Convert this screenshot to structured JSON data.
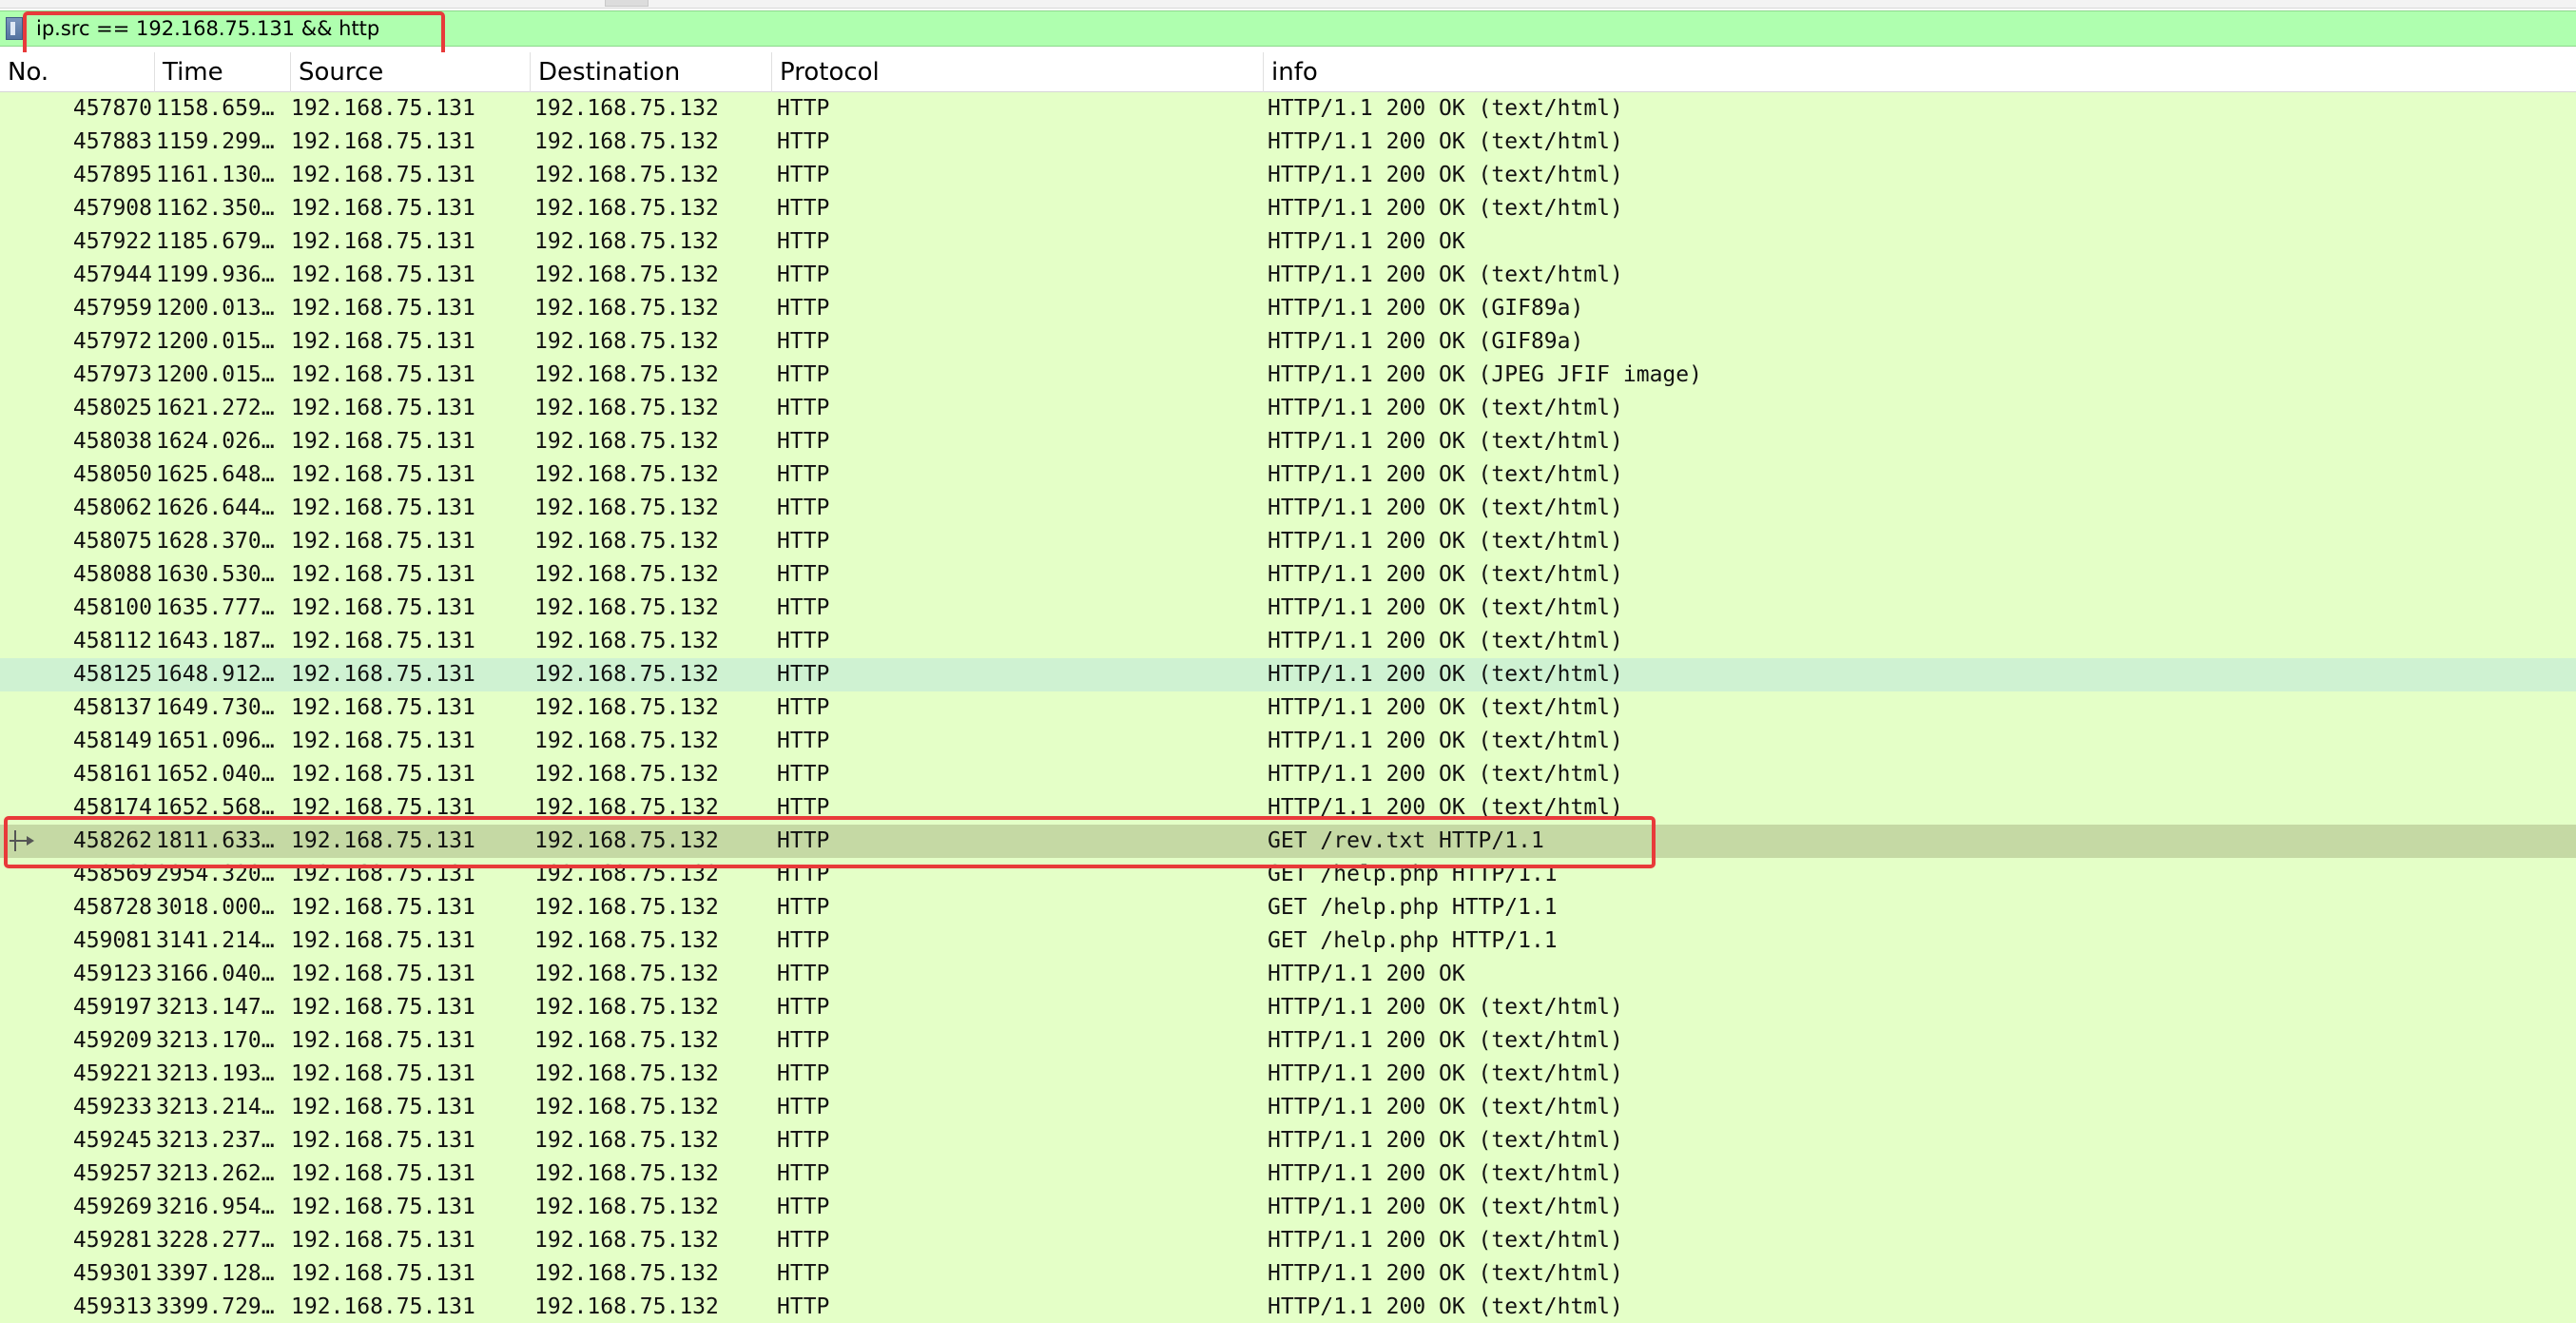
{
  "filter": {
    "value": "ip.src == 192.168.75.131 && http"
  },
  "columns": [
    "No.",
    "Time",
    "Source",
    "Destination",
    "Protocol",
    "info"
  ],
  "rows": [
    {
      "no": "457870",
      "time": "1158.659…",
      "src": "192.168.75.131",
      "dst": "192.168.75.132",
      "proto": "HTTP",
      "info": "HTTP/1.1 200 OK  (text/html)"
    },
    {
      "no": "457883",
      "time": "1159.299…",
      "src": "192.168.75.131",
      "dst": "192.168.75.132",
      "proto": "HTTP",
      "info": "HTTP/1.1 200 OK  (text/html)"
    },
    {
      "no": "457895",
      "time": "1161.130…",
      "src": "192.168.75.131",
      "dst": "192.168.75.132",
      "proto": "HTTP",
      "info": "HTTP/1.1 200 OK  (text/html)"
    },
    {
      "no": "457908",
      "time": "1162.350…",
      "src": "192.168.75.131",
      "dst": "192.168.75.132",
      "proto": "HTTP",
      "info": "HTTP/1.1 200 OK  (text/html)"
    },
    {
      "no": "457922",
      "time": "1185.679…",
      "src": "192.168.75.131",
      "dst": "192.168.75.132",
      "proto": "HTTP",
      "info": "HTTP/1.1 200 OK"
    },
    {
      "no": "457944",
      "time": "1199.936…",
      "src": "192.168.75.131",
      "dst": "192.168.75.132",
      "proto": "HTTP",
      "info": "HTTP/1.1 200 OK  (text/html)"
    },
    {
      "no": "457959",
      "time": "1200.013…",
      "src": "192.168.75.131",
      "dst": "192.168.75.132",
      "proto": "HTTP",
      "info": "HTTP/1.1 200 OK  (GIF89a)"
    },
    {
      "no": "457972",
      "time": "1200.015…",
      "src": "192.168.75.131",
      "dst": "192.168.75.132",
      "proto": "HTTP",
      "info": "HTTP/1.1 200 OK  (GIF89a)"
    },
    {
      "no": "457973",
      "time": "1200.015…",
      "src": "192.168.75.131",
      "dst": "192.168.75.132",
      "proto": "HTTP",
      "info": "HTTP/1.1 200 OK  (JPEG JFIF image)"
    },
    {
      "no": "458025",
      "time": "1621.272…",
      "src": "192.168.75.131",
      "dst": "192.168.75.132",
      "proto": "HTTP",
      "info": "HTTP/1.1 200 OK  (text/html)"
    },
    {
      "no": "458038",
      "time": "1624.026…",
      "src": "192.168.75.131",
      "dst": "192.168.75.132",
      "proto": "HTTP",
      "info": "HTTP/1.1 200 OK  (text/html)"
    },
    {
      "no": "458050",
      "time": "1625.648…",
      "src": "192.168.75.131",
      "dst": "192.168.75.132",
      "proto": "HTTP",
      "info": "HTTP/1.1 200 OK  (text/html)"
    },
    {
      "no": "458062",
      "time": "1626.644…",
      "src": "192.168.75.131",
      "dst": "192.168.75.132",
      "proto": "HTTP",
      "info": "HTTP/1.1 200 OK  (text/html)"
    },
    {
      "no": "458075",
      "time": "1628.370…",
      "src": "192.168.75.131",
      "dst": "192.168.75.132",
      "proto": "HTTP",
      "info": "HTTP/1.1 200 OK  (text/html)"
    },
    {
      "no": "458088",
      "time": "1630.530…",
      "src": "192.168.75.131",
      "dst": "192.168.75.132",
      "proto": "HTTP",
      "info": "HTTP/1.1 200 OK  (text/html)"
    },
    {
      "no": "458100",
      "time": "1635.777…",
      "src": "192.168.75.131",
      "dst": "192.168.75.132",
      "proto": "HTTP",
      "info": "HTTP/1.1 200 OK  (text/html)"
    },
    {
      "no": "458112",
      "time": "1643.187…",
      "src": "192.168.75.131",
      "dst": "192.168.75.132",
      "proto": "HTTP",
      "info": "HTTP/1.1 200 OK  (text/html)"
    },
    {
      "no": "458125",
      "time": "1648.912…",
      "src": "192.168.75.131",
      "dst": "192.168.75.132",
      "proto": "HTTP",
      "info": "HTTP/1.1 200 OK  (text/html)",
      "state": "hover"
    },
    {
      "no": "458137",
      "time": "1649.730…",
      "src": "192.168.75.131",
      "dst": "192.168.75.132",
      "proto": "HTTP",
      "info": "HTTP/1.1 200 OK  (text/html)"
    },
    {
      "no": "458149",
      "time": "1651.096…",
      "src": "192.168.75.131",
      "dst": "192.168.75.132",
      "proto": "HTTP",
      "info": "HTTP/1.1 200 OK  (text/html)"
    },
    {
      "no": "458161",
      "time": "1652.040…",
      "src": "192.168.75.131",
      "dst": "192.168.75.132",
      "proto": "HTTP",
      "info": "HTTP/1.1 200 OK  (text/html)"
    },
    {
      "no": "458174",
      "time": "1652.568…",
      "src": "192.168.75.131",
      "dst": "192.168.75.132",
      "proto": "HTTP",
      "info": "HTTP/1.1 200 OK  (text/html)"
    },
    {
      "no": "458262",
      "time": "1811.633…",
      "src": "192.168.75.131",
      "dst": "192.168.75.132",
      "proto": "HTTP",
      "info": "GET /rev.txt HTTP/1.1",
      "state": "selected"
    },
    {
      "no": "458569",
      "time": "2954.320…",
      "src": "192.168.75.131",
      "dst": "192.168.75.132",
      "proto": "HTTP",
      "info": "GET /help.php HTTP/1.1"
    },
    {
      "no": "458728",
      "time": "3018.000…",
      "src": "192.168.75.131",
      "dst": "192.168.75.132",
      "proto": "HTTP",
      "info": "GET /help.php HTTP/1.1"
    },
    {
      "no": "459081",
      "time": "3141.214…",
      "src": "192.168.75.131",
      "dst": "192.168.75.132",
      "proto": "HTTP",
      "info": "GET /help.php HTTP/1.1"
    },
    {
      "no": "459123",
      "time": "3166.040…",
      "src": "192.168.75.131",
      "dst": "192.168.75.132",
      "proto": "HTTP",
      "info": "HTTP/1.1 200 OK"
    },
    {
      "no": "459197",
      "time": "3213.147…",
      "src": "192.168.75.131",
      "dst": "192.168.75.132",
      "proto": "HTTP",
      "info": "HTTP/1.1 200 OK  (text/html)"
    },
    {
      "no": "459209",
      "time": "3213.170…",
      "src": "192.168.75.131",
      "dst": "192.168.75.132",
      "proto": "HTTP",
      "info": "HTTP/1.1 200 OK  (text/html)"
    },
    {
      "no": "459221",
      "time": "3213.193…",
      "src": "192.168.75.131",
      "dst": "192.168.75.132",
      "proto": "HTTP",
      "info": "HTTP/1.1 200 OK  (text/html)"
    },
    {
      "no": "459233",
      "time": "3213.214…",
      "src": "192.168.75.131",
      "dst": "192.168.75.132",
      "proto": "HTTP",
      "info": "HTTP/1.1 200 OK  (text/html)"
    },
    {
      "no": "459245",
      "time": "3213.237…",
      "src": "192.168.75.131",
      "dst": "192.168.75.132",
      "proto": "HTTP",
      "info": "HTTP/1.1 200 OK  (text/html)"
    },
    {
      "no": "459257",
      "time": "3213.262…",
      "src": "192.168.75.131",
      "dst": "192.168.75.132",
      "proto": "HTTP",
      "info": "HTTP/1.1 200 OK  (text/html)"
    },
    {
      "no": "459269",
      "time": "3216.954…",
      "src": "192.168.75.131",
      "dst": "192.168.75.132",
      "proto": "HTTP",
      "info": "HTTP/1.1 200 OK  (text/html)"
    },
    {
      "no": "459281",
      "time": "3228.277…",
      "src": "192.168.75.131",
      "dst": "192.168.75.132",
      "proto": "HTTP",
      "info": "HTTP/1.1 200 OK  (text/html)"
    },
    {
      "no": "459301",
      "time": "3397.128…",
      "src": "192.168.75.131",
      "dst": "192.168.75.132",
      "proto": "HTTP",
      "info": "HTTP/1.1 200 OK  (text/html)"
    },
    {
      "no": "459313",
      "time": "3399.729…",
      "src": "192.168.75.131",
      "dst": "192.168.75.132",
      "proto": "HTTP",
      "info": "HTTP/1.1 200 OK  (text/html)"
    }
  ],
  "colors": {
    "filter_valid_bg": "#afffaf",
    "row_http_bg": "#e4ffc7",
    "row_hover_bg": "#cff2d2",
    "row_selected_bg": "#c5d9a4",
    "annotation_red": "#e83a3a"
  },
  "icons": {
    "filter_bookmark": "bookmark-icon",
    "selected_row_marker": "related-packet-arrow-icon"
  }
}
